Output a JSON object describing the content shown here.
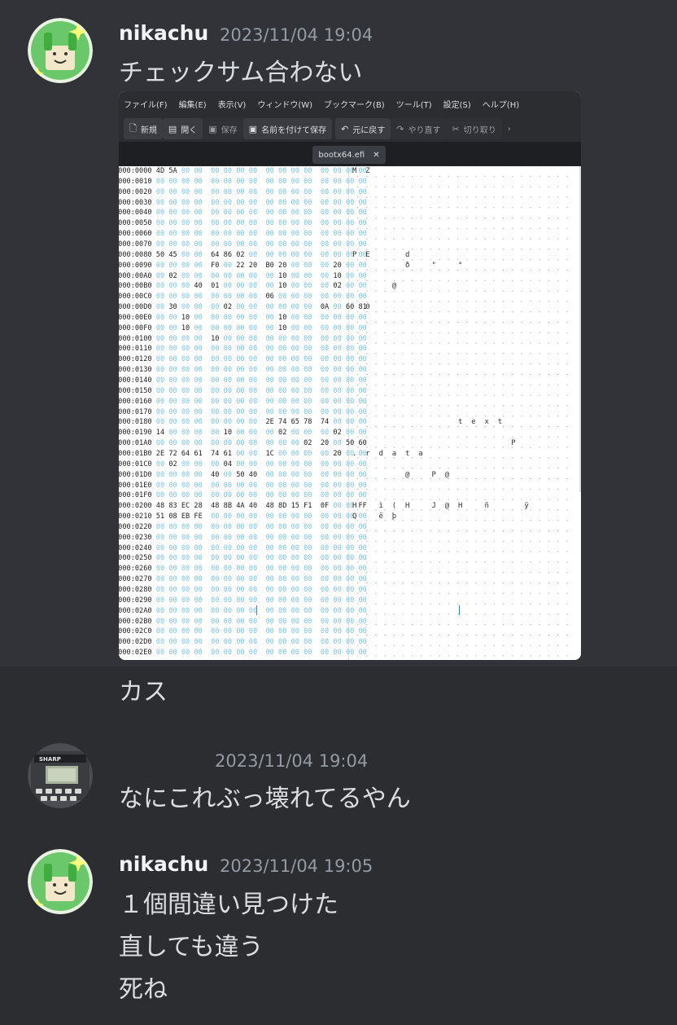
{
  "messages": [
    {
      "username": "nikachu",
      "timestamp": "2023/11/04 19:04",
      "text": "チェックサム合わない",
      "followup": "カス"
    },
    {
      "username": "",
      "timestamp": "2023/11/04 19:04",
      "text": "なにこれぶっ壊れてるやん"
    },
    {
      "username": "nikachu",
      "timestamp": "2023/11/04 19:05",
      "lines": [
        "１個間違い見つけた",
        "直しても違う",
        "死ね"
      ]
    }
  ],
  "editor": {
    "menu": [
      "ファイル(F)",
      "編集(E)",
      "表示(V)",
      "ウィンドウ(W)",
      "ブックマーク(B)",
      "ツール(T)",
      "設定(S)",
      "ヘルプ(H)"
    ],
    "toolbar": {
      "new": "新規",
      "open": "開く",
      "save": "保存",
      "save_as": "名前を付けて保存",
      "undo": "元に戻す",
      "redo": "やり直す",
      "cut": "切り取り"
    },
    "tab_name": "bootx64.efi",
    "rows": [
      {
        "addr": "0000:0000",
        "bytes": "4D 5A 00 00  00 00 00 00  00 00 00 00  00 00 00 00",
        "ascii": "M  Z"
      },
      {
        "addr": "0000:0010",
        "bytes": "00 00 00 00  00 00 00 00  00 00 00 00  00 00 00 00",
        "ascii": ""
      },
      {
        "addr": "0000:0020",
        "bytes": "00 00 00 00  00 00 00 00  00 00 00 00  00 00 00 00",
        "ascii": ""
      },
      {
        "addr": "0000:0030",
        "bytes": "00 00 00 00  00 00 00 00  00 00 00 00  00 00 00 00",
        "ascii": ""
      },
      {
        "addr": "0000:0040",
        "bytes": "00 00 00 00  00 00 00 00  00 00 00 00  00 00 00 00",
        "ascii": ""
      },
      {
        "addr": "0000:0050",
        "bytes": "00 00 00 00  00 00 00 00  00 00 00 00  00 00 00 00",
        "ascii": ""
      },
      {
        "addr": "0000:0060",
        "bytes": "00 00 00 00  00 00 00 00  00 00 00 00  00 00 00 00",
        "ascii": ""
      },
      {
        "addr": "0000:0070",
        "bytes": "00 00 00 00  00 00 00 00  00 00 00 00  00 00 00 00",
        "ascii": ""
      },
      {
        "addr": "0000:0080",
        "bytes": "50 45 00 00  64 86 02 00  00 00 00 00  00 00 00 00",
        "ascii": "P  E        d"
      },
      {
        "addr": "0000:0090",
        "bytes": "00 00 00 00  F0 00 22 20  B0 20 00 00  00 20 00 00",
        "ascii": "            ð     \"     °"
      },
      {
        "addr": "0000:00A0",
        "bytes": "00 02 00 00  00 00 00 00  00 10 00 00  00 10 00 00",
        "ascii": ""
      },
      {
        "addr": "0000:00B0",
        "bytes": "00 00 00 40  01 00 00 00  00 10 00 00  00 02 00 00",
        "ascii": "         @"
      },
      {
        "addr": "0000:00C0",
        "bytes": "00 00 00 00  00 00 00 00  06 00 00 00  00 00 00 00",
        "ascii": ""
      },
      {
        "addr": "0000:00D0",
        "bytes": "00 30 00 00  00 02 00 00  00 00 00 00  0A 00 60 81",
        "ascii": "   0"
      },
      {
        "addr": "0000:00E0",
        "bytes": "00 00 10 00  00 00 00 00  00 10 00 00  00 00 00 00",
        "ascii": ""
      },
      {
        "addr": "0000:00F0",
        "bytes": "00 00 10 00  00 00 00 00  00 10 00 00  00 00 00 00",
        "ascii": ""
      },
      {
        "addr": "0000:0100",
        "bytes": "00 00 00 00  10 00 00 00  00 00 00 00  00 00 00 00",
        "ascii": ""
      },
      {
        "addr": "0000:0110",
        "bytes": "00 00 00 00  00 00 00 00  00 00 00 00  00 00 00 00",
        "ascii": ""
      },
      {
        "addr": "0000:0120",
        "bytes": "00 00 00 00  00 00 00 00  00 00 00 00  00 00 00 00",
        "ascii": ""
      },
      {
        "addr": "0000:0130",
        "bytes": "00 00 00 00  00 00 00 00  00 00 00 00  00 00 00 00",
        "ascii": ""
      },
      {
        "addr": "0000:0140",
        "bytes": "00 00 00 00  00 00 00 00  00 00 00 00  00 00 00 00",
        "ascii": ""
      },
      {
        "addr": "0000:0150",
        "bytes": "00 00 00 00  00 00 00 00  00 00 00 00  00 00 00 00",
        "ascii": ""
      },
      {
        "addr": "0000:0160",
        "bytes": "00 00 00 00  00 00 00 00  00 00 00 00  00 00 00 00",
        "ascii": ""
      },
      {
        "addr": "0000:0170",
        "bytes": "00 00 00 00  00 00 00 00  00 00 00 00  00 00 00 00",
        "ascii": ""
      },
      {
        "addr": "0000:0180",
        "bytes": "00 00 00 00  00 00 00 00  2E 74 65 78  74 00 00 00",
        "ascii": "                        t  e  x  t"
      },
      {
        "addr": "0000:0190",
        "bytes": "14 00 00 00  00 10 00 00  00 02 00 00  00 02 00 00",
        "ascii": ""
      },
      {
        "addr": "0000:01A0",
        "bytes": "00 00 00 00  00 00 00 00  00 00 00 02  20 00 50 60",
        "ascii": "                                    P"
      },
      {
        "addr": "0000:01B0",
        "bytes": "2E 72 64 61  74 61 00 00  1C 00 00 00  00 20 00 00",
        "ascii": ".  r  d  a  t  a"
      },
      {
        "addr": "0000:01C0",
        "bytes": "00 02 00 00  00 04 00 00  00 00 00 00  00 00 00 00",
        "ascii": ""
      },
      {
        "addr": "0000:01D0",
        "bytes": "00 00 00 00  40 00 50 40  00 00 00 00  00 00 00 00",
        "ascii": "            @     P  @"
      },
      {
        "addr": "0000:01E0",
        "bytes": "00 00 00 00  00 00 00 00  00 00 00 00  00 00 00 00",
        "ascii": ""
      },
      {
        "addr": "0000:01F0",
        "bytes": "00 00 00 00  00 00 00 00  00 00 00 00  00 00 00 00",
        "ascii": ""
      },
      {
        "addr": "0000:0200",
        "bytes": "48 83 EC 28  48 8B 4A 40  48 8D 15 F1  0F 00 00 FF",
        "ascii": "H     ì  (  H     J  @  H     ñ        ÿ"
      },
      {
        "addr": "0000:0210",
        "bytes": "51 08 EB FE  00 00 00 00  00 00 00 00  00 00 00 00",
        "ascii": "Q     ë  þ"
      },
      {
        "addr": "0000:0220",
        "bytes": "00 00 00 00  00 00 00 00  00 00 00 00  00 00 00 00",
        "ascii": ""
      },
      {
        "addr": "0000:0230",
        "bytes": "00 00 00 00  00 00 00 00  00 00 00 00  00 00 00 00",
        "ascii": ""
      },
      {
        "addr": "0000:0240",
        "bytes": "00 00 00 00  00 00 00 00  00 00 00 00  00 00 00 00",
        "ascii": ""
      },
      {
        "addr": "0000:0250",
        "bytes": "00 00 00 00  00 00 00 00  00 00 00 00  00 00 00 00",
        "ascii": ""
      },
      {
        "addr": "0000:0260",
        "bytes": "00 00 00 00  00 00 00 00  00 00 00 00  00 00 00 00",
        "ascii": ""
      },
      {
        "addr": "0000:0270",
        "bytes": "00 00 00 00  00 00 00 00  00 00 00 00  00 00 00 00",
        "ascii": ""
      },
      {
        "addr": "0000:0280",
        "bytes": "00 00 00 00  00 00 00 00  00 00 00 00  00 00 00 00",
        "ascii": ""
      },
      {
        "addr": "0000:0290",
        "bytes": "00 00 00 00  00 00 00 00  00 00 00 00  00 00 00 00",
        "ascii": ""
      },
      {
        "addr": "0000:02A0",
        "bytes": "00 00 00 00  00 00 00 00  00 00 00 00  00 00 00 00",
        "ascii": ""
      },
      {
        "addr": "0000:02B0",
        "bytes": "00 00 00 00  00 00 00 00  00 00 00 00  00 00 00 00",
        "ascii": ""
      },
      {
        "addr": "0000:02C0",
        "bytes": "00 00 00 00  00 00 00 00  00 00 00 00  00 00 00 00",
        "ascii": ""
      },
      {
        "addr": "0000:02D0",
        "bytes": "00 00 00 00  00 00 00 00  00 00 00 00  00 00 00 00",
        "ascii": ""
      },
      {
        "addr": "0000:02E0",
        "bytes": "00 00 00 00  00 00 00 00  00 00 00 00  00 00 00 00",
        "ascii": ""
      }
    ]
  },
  "colors": {
    "bg": "#313338",
    "username": "#f2f3f5",
    "timestamp": "#949ba4",
    "hex_zero": "#7fc6ee"
  },
  "icons": [
    "avatar-nikachu",
    "avatar-sharp-calculator"
  ]
}
